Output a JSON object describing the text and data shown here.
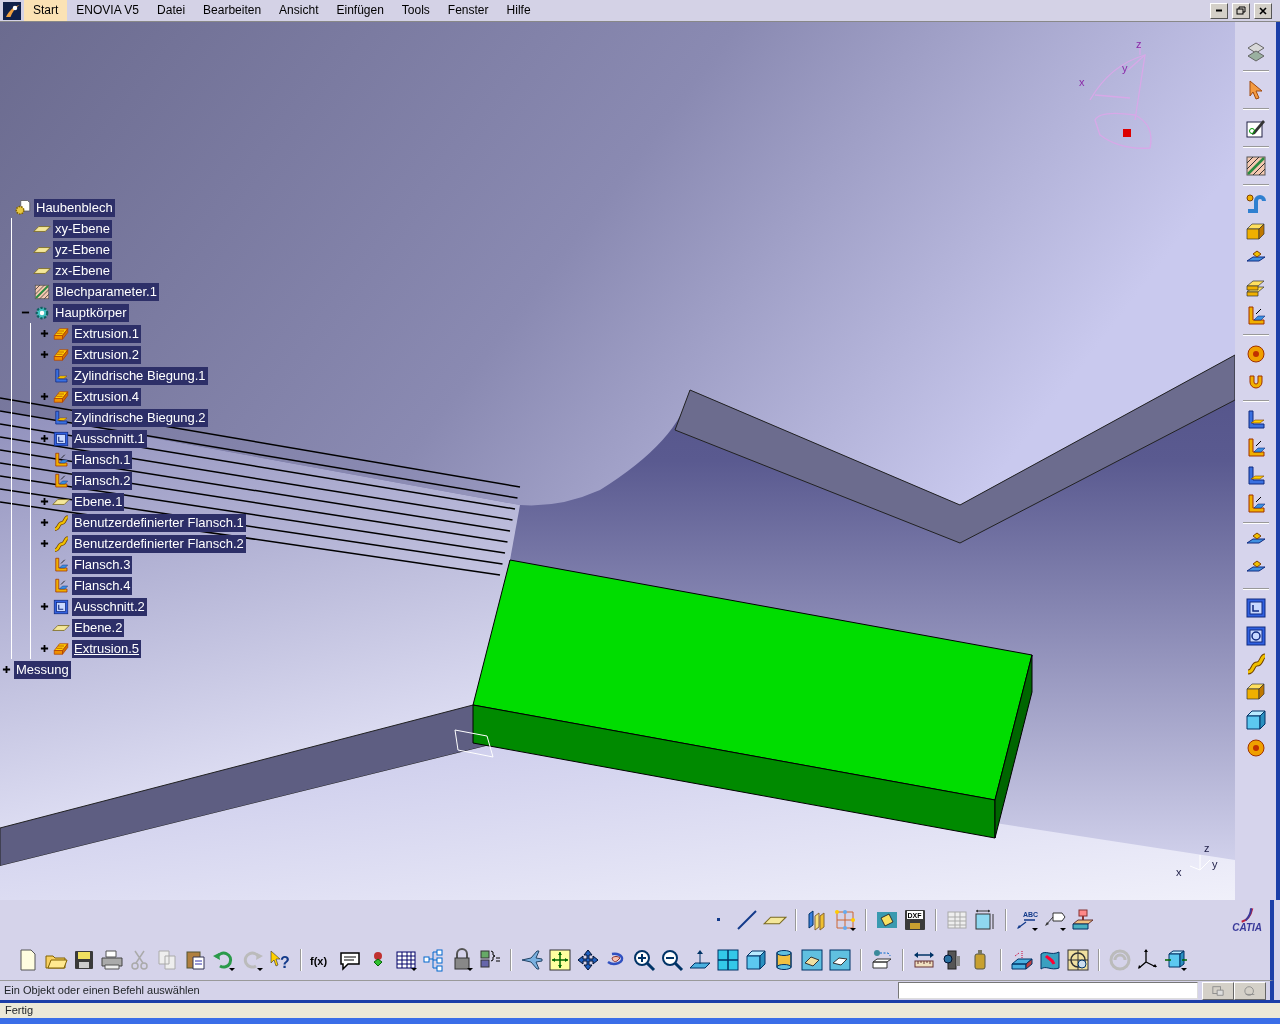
{
  "menu": [
    {
      "label": "Start",
      "highlighted": true
    },
    {
      "label": "ENOVIA V5",
      "highlighted": false
    },
    {
      "label": "Datei",
      "highlighted": false
    },
    {
      "label": "Bearbeiten",
      "highlighted": false
    },
    {
      "label": "Ansicht",
      "highlighted": false
    },
    {
      "label": "Einfügen",
      "highlighted": false
    },
    {
      "label": "Tools",
      "highlighted": false
    },
    {
      "label": "Fenster",
      "highlighted": false
    },
    {
      "label": "Hilfe",
      "highlighted": false
    }
  ],
  "tree": [
    {
      "label": "Haubenblech",
      "kind": "part",
      "current": false,
      "children": [
        {
          "label": "xy-Ebene",
          "kind": "plane",
          "current": false
        },
        {
          "label": "yz-Ebene",
          "kind": "plane",
          "current": false
        },
        {
          "label": "zx-Ebene",
          "kind": "plane",
          "current": false
        },
        {
          "label": "Blechparameter.1",
          "kind": "params",
          "current": false
        },
        {
          "label": "Hauptkörper",
          "kind": "body",
          "expanded": true,
          "current": false,
          "children": [
            {
              "label": "Extrusion.1",
              "kind": "extrusion",
              "expanded": false,
              "current": false
            },
            {
              "label": "Extrusion.2",
              "kind": "extrusion",
              "expanded": false,
              "current": false
            },
            {
              "label": "Zylindrische Biegung.1",
              "kind": "bend",
              "current": false
            },
            {
              "label": "Extrusion.4",
              "kind": "extrusion",
              "expanded": false,
              "current": false
            },
            {
              "label": "Zylindrische Biegung.2",
              "kind": "bend",
              "current": false
            },
            {
              "label": "Ausschnitt.1",
              "kind": "cutout",
              "expanded": false,
              "current": false
            },
            {
              "label": "Flansch.1",
              "kind": "flange",
              "current": false
            },
            {
              "label": "Flansch.2",
              "kind": "flange",
              "current": false
            },
            {
              "label": "Ebene.1",
              "kind": "plane",
              "expanded": false,
              "current": false
            },
            {
              "label": "Benutzerdefinierter Flansch.1",
              "kind": "custom_flange",
              "expanded": false,
              "current": false
            },
            {
              "label": "Benutzerdefinierter Flansch.2",
              "kind": "custom_flange",
              "expanded": false,
              "current": false
            },
            {
              "label": "Flansch.3",
              "kind": "flange",
              "current": false
            },
            {
              "label": "Flansch.4",
              "kind": "flange",
              "current": false
            },
            {
              "label": "Ausschnitt.2",
              "kind": "cutout",
              "expanded": false,
              "current": false
            },
            {
              "label": "Ebene.2",
              "kind": "plane",
              "current": false
            },
            {
              "label": "Extrusion.5",
              "kind": "extrusion",
              "expanded": false,
              "current": true
            }
          ]
        }
      ]
    },
    {
      "label": "Messung",
      "kind": "measure",
      "expanded": false,
      "current": false
    }
  ],
  "compass": {
    "labels": [
      "x",
      "y",
      "z"
    ]
  },
  "axis_triad": {
    "labels": [
      "x",
      "y",
      "z"
    ]
  },
  "toolbar_labels": {
    "dxf": "DXF",
    "abc": "ABC",
    "fx": "f(x)",
    "help": "?"
  },
  "logo": {
    "text": "CATIA"
  },
  "status_bar": {
    "prompt": "Ein Objekt oder einen Befehl auswählen"
  },
  "taskbar": {
    "status": "Fertig"
  }
}
